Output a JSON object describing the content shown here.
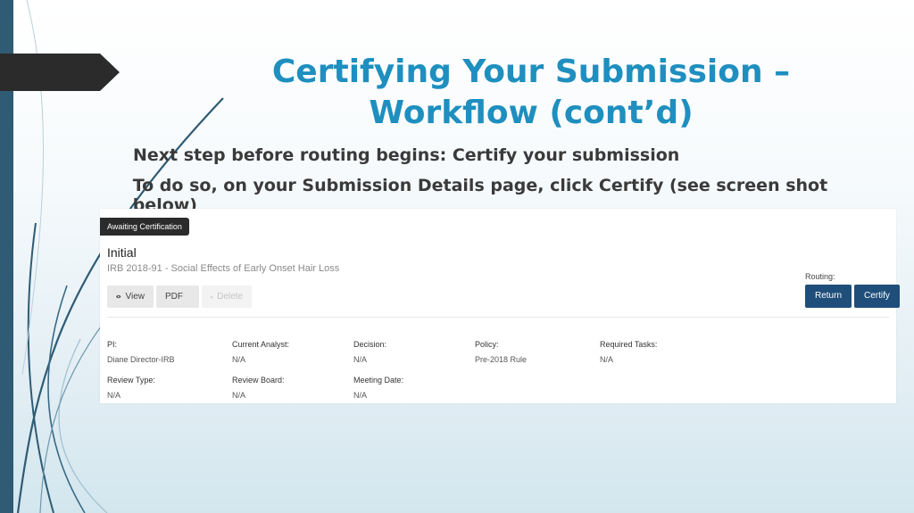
{
  "slide": {
    "title_line1": "Certifying Your Submission –",
    "title_line2": "Workflow (cont’d)",
    "bullet_glyph": "",
    "bullets": [
      "Next step before routing begins: Certify your submission",
      "To do so, on your Submission Details page, click Certify (see screen shot below)"
    ]
  },
  "screenshot": {
    "status_tag": "Awaiting Certification",
    "heading": "Initial",
    "submission_name": "IRB 2018-91 - Social Effects of Early Onset Hair Loss",
    "buttons": {
      "view": "View",
      "pdf": "PDF",
      "delete": "Delete"
    },
    "icons": {
      "view": "eye-icon",
      "pdf": "caret-down-icon",
      "delete": "trash-icon"
    },
    "routing_label": "Routing:",
    "return_label": "Return",
    "certify_label": "Certify",
    "fields": [
      {
        "label": "PI:",
        "value": "Diane Director-IRB"
      },
      {
        "label": "Current Analyst:",
        "value": "N/A"
      },
      {
        "label": "Decision:",
        "value": "N/A"
      },
      {
        "label": "Policy:",
        "value": "Pre-2018 Rule"
      },
      {
        "label": "Required Tasks:",
        "value": "N/A"
      },
      {
        "label": "Review Type:",
        "value": "N/A"
      },
      {
        "label": "Review Board:",
        "value": "N/A"
      },
      {
        "label": "Meeting Date:",
        "value": "N/A"
      }
    ]
  }
}
